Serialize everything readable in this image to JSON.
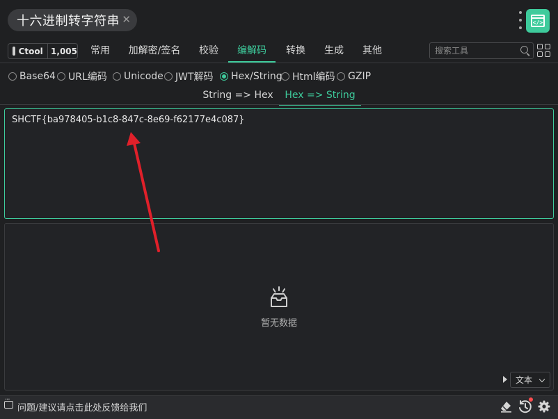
{
  "window": {
    "title": "十六进制转字符串",
    "close_symbol": "✕"
  },
  "nav": {
    "ctool_label": "Ctool",
    "ctool_count": "1,005",
    "tabs": [
      {
        "label": "常用"
      },
      {
        "label": "加解密/签名"
      },
      {
        "label": "校验"
      },
      {
        "label": "编解码"
      },
      {
        "label": "转换"
      },
      {
        "label": "生成"
      },
      {
        "label": "其他"
      }
    ],
    "active_tab": "编解码",
    "search_placeholder": "搜索工具"
  },
  "tools": {
    "items": [
      {
        "label": "Base64"
      },
      {
        "label": "URL编码"
      },
      {
        "label": "Unicode"
      },
      {
        "label": "JWT解码"
      },
      {
        "label": "Hex/String"
      },
      {
        "label": "Html编码"
      },
      {
        "label": "GZIP"
      }
    ],
    "selected": "Hex/String"
  },
  "subtabs": {
    "items": [
      {
        "label": "String => Hex"
      },
      {
        "label": "Hex => String"
      }
    ],
    "active": "Hex => String"
  },
  "input": {
    "value": "SHCTF{ba978405-b1c8-847c-8e69-f62177e4c087}"
  },
  "output": {
    "empty_text": "暂无数据",
    "format_select": "文本"
  },
  "footer": {
    "feedback_text": "问题/建议请点击此处反馈给我们"
  },
  "colors": {
    "accent": "#3ecb9c",
    "background": "#1f2022",
    "annotation_arrow": "#e0202a",
    "notification_dot": "#ff4d4f"
  }
}
